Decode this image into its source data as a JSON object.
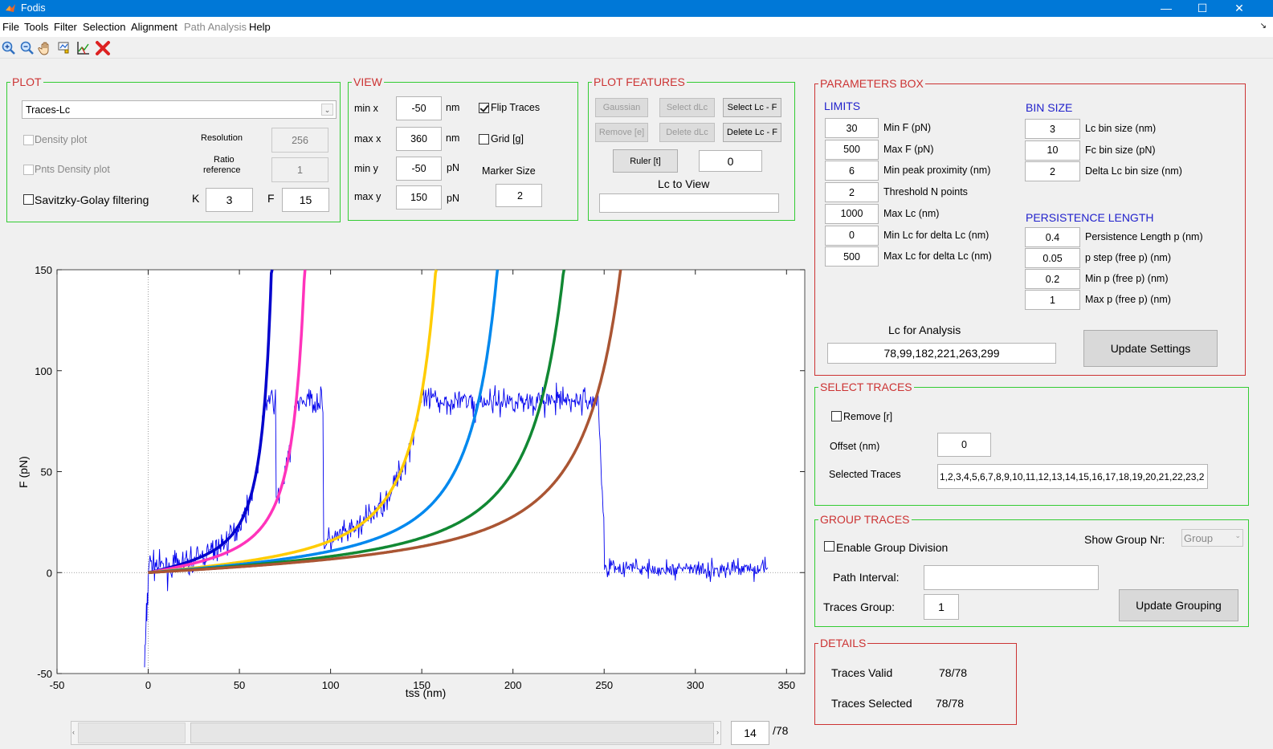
{
  "window": {
    "title": "Fodis",
    "min": "—",
    "max": "☐",
    "close": "✕"
  },
  "menu": [
    "File",
    "Tools",
    "Filter",
    "Selection",
    "Alignment",
    "Path Analysis",
    "Help"
  ],
  "plot_panel": {
    "title": "PLOT",
    "dropdown": "Traces-Lc",
    "density": "Density plot",
    "resolution_label": "Resolution",
    "resolution": "256",
    "pnts_density": "Pnts Density plot",
    "ratio_label1": "Ratio",
    "ratio_label2": "reference",
    "ratio": "1",
    "sg": "Savitzky-Golay filtering",
    "k_label": "K",
    "k": "3",
    "f_label": "F",
    "f": "15"
  },
  "view_panel": {
    "title": "VIEW",
    "minx_label": "min x",
    "minx": "-50",
    "maxx_label": "max x",
    "maxx": "360",
    "miny_label": "min y",
    "miny": "-50",
    "maxy_label": "max y",
    "maxy": "150",
    "nm": "nm",
    "pn": "pN",
    "flip": "Flip Traces",
    "grid": "Grid [g]",
    "marker_label": "Marker Size",
    "marker": "2"
  },
  "features_panel": {
    "title": "PLOT FEATURES",
    "gaussian": "Gaussian",
    "select_dlc": "Select  dLc",
    "select_lcf": "Select Lc - F",
    "remove": "Remove [e]",
    "delete_dlc": "Delete dLc",
    "delete_lcf": "Delete Lc - F",
    "ruler": "Ruler [t]",
    "ruler_val": "0",
    "lc_view_label": "Lc to View",
    "lc_view": ""
  },
  "params": {
    "title": "PARAMETERS BOX",
    "limits": "LIMITS",
    "bin_size": "BIN SIZE",
    "persistence": "PERSISTENCE LENGTH",
    "limit_rows": [
      {
        "v": "30",
        "l": "Min F (pN)"
      },
      {
        "v": "500",
        "l": "Max F (pN)"
      },
      {
        "v": "6",
        "l": "Min peak proximity (nm)"
      },
      {
        "v": "2",
        "l": "Threshold N points"
      },
      {
        "v": "1000",
        "l": "Max Lc (nm)"
      },
      {
        "v": "0",
        "l": "Min Lc for delta Lc (nm)"
      },
      {
        "v": "500",
        "l": "Max Lc for delta Lc (nm)"
      }
    ],
    "bin_rows": [
      {
        "v": "3",
        "l": "Lc bin size (nm)"
      },
      {
        "v": "10",
        "l": "Fc bin size (pN)"
      },
      {
        "v": "2",
        "l": "Delta Lc bin size (nm)"
      }
    ],
    "pers_rows": [
      {
        "v": "0.4",
        "l": "Persistence Length p (nm)"
      },
      {
        "v": "0.05",
        "l": "p step (free p) (nm)"
      },
      {
        "v": "0.2",
        "l": "Min p (free p) (nm)"
      },
      {
        "v": "1",
        "l": "Max p (free p) (nm)"
      }
    ],
    "lc_analysis_label": "Lc for Analysis",
    "lc_analysis": "78,99,182,221,263,299",
    "update": "Update Settings"
  },
  "select_traces": {
    "title": "SELECT TRACES",
    "remove": "Remove [r]",
    "offset_label": "Offset (nm)",
    "offset": "0",
    "selected_label": "Selected Traces",
    "selected": "1,2,3,4,5,6,7,8,9,10,11,12,13,14,15,16,17,18,19,20,21,22,23,2"
  },
  "group_traces": {
    "title": "GROUP TRACES",
    "enable": "Enable Group Division",
    "show_label": "Show Group Nr:",
    "show": "Group",
    "path_label": "Path Interval:",
    "path": "",
    "traces_group_label": "Traces Group:",
    "traces_group": "1",
    "update": "Update Grouping"
  },
  "details": {
    "title": "DETAILS",
    "valid_label": "Traces Valid",
    "valid": "78/78",
    "selected_label": "Traces Selected",
    "selected": "78/78"
  },
  "nav": {
    "index": "14",
    "total": "/78"
  },
  "chart_data": {
    "type": "line",
    "xlabel": "tss (nm)",
    "ylabel": "F (pN)",
    "xlim": [
      -50,
      360
    ],
    "ylim": [
      -50,
      150
    ],
    "xticks": [
      "-50",
      "0",
      "50",
      "100",
      "150",
      "200",
      "250",
      "300",
      "350"
    ],
    "yticks": [
      "-50",
      "0",
      "50",
      "100",
      "150"
    ],
    "wlc_curves": [
      {
        "lc": 78,
        "color": "#0000cc"
      },
      {
        "lc": 99,
        "color": "#ff33bb"
      },
      {
        "lc": 182,
        "color": "#ffcc00"
      },
      {
        "lc": 221,
        "color": "#0088ee"
      },
      {
        "lc": 263,
        "color": "#118833"
      },
      {
        "lc": 299,
        "color": "#aa5533"
      }
    ],
    "persistence_nm": 0.4,
    "trace_color": "#0000ee"
  }
}
